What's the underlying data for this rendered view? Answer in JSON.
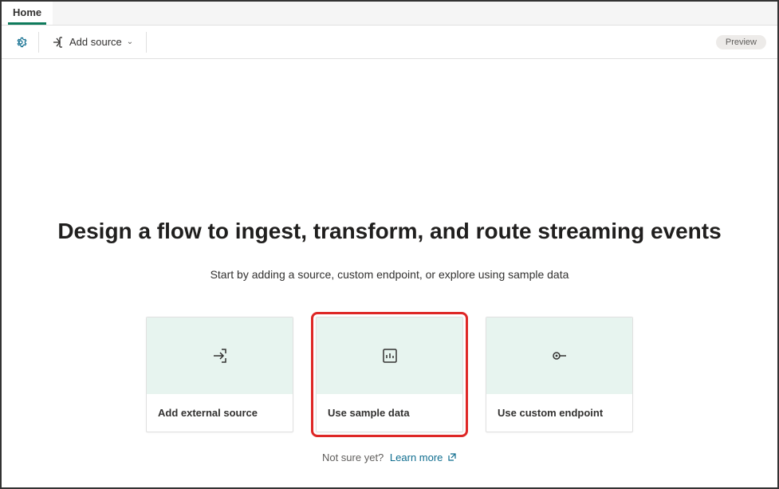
{
  "tabs": {
    "home": "Home"
  },
  "toolbar": {
    "add_source_label": "Add source",
    "preview_badge": "Preview"
  },
  "main": {
    "heading": "Design a flow to ingest, transform, and route streaming events",
    "subtext": "Start by adding a source, custom endpoint, or explore using sample data"
  },
  "cards": {
    "external_source": "Add external source",
    "sample_data": "Use sample data",
    "custom_endpoint": "Use custom endpoint"
  },
  "footer": {
    "not_sure": "Not sure yet?",
    "learn_more": "Learn more"
  }
}
